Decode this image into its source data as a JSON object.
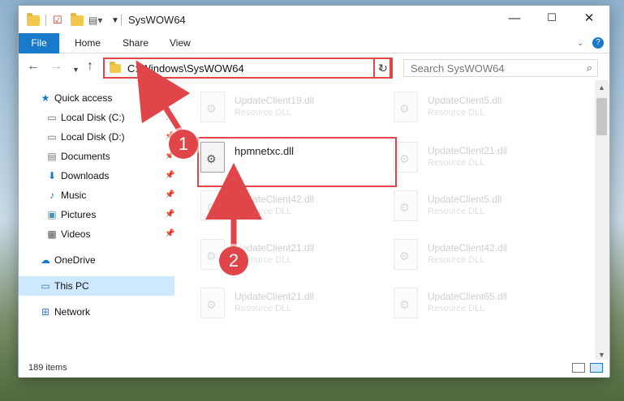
{
  "window": {
    "title": "SysWOW64",
    "controls": {
      "minimize": "—",
      "maximize": "☐",
      "close": "✕"
    }
  },
  "ribbon": {
    "tabs": [
      "File",
      "Home",
      "Share",
      "View"
    ]
  },
  "nav": {
    "address": "C:\\Windows\\SysWOW64",
    "search_placeholder": "Search SysWOW64"
  },
  "sidebar": {
    "items": [
      {
        "label": "Quick access",
        "icon": "star-icon"
      },
      {
        "label": "Local Disk (C:)",
        "icon": "drive-icon"
      },
      {
        "label": "Local Disk (D:)",
        "icon": "drive-icon"
      },
      {
        "label": "Documents",
        "icon": "documents-icon"
      },
      {
        "label": "Downloads",
        "icon": "download-icon"
      },
      {
        "label": "Music",
        "icon": "music-icon"
      },
      {
        "label": "Pictures",
        "icon": "pictures-icon"
      },
      {
        "label": "Videos",
        "icon": "videos-icon"
      },
      {
        "label": "OneDrive",
        "icon": "cloud-icon"
      },
      {
        "label": "This PC",
        "icon": "computer-icon"
      },
      {
        "label": "Network",
        "icon": "network-icon"
      }
    ]
  },
  "files": {
    "highlighted": {
      "name": "hpmnetxc.dll"
    },
    "faded": [
      {
        "name": "UpdateClient19.dll",
        "type": "Resource DLL"
      },
      {
        "name": "UpdateClient5.dll",
        "type": "Resource DLL"
      },
      {
        "name": "UpdateClient21.dll",
        "type": "Resource DLL"
      },
      {
        "name": "UpdateClient42.dll",
        "type": "Resource DLL"
      },
      {
        "name": "UpdateClient5.dll",
        "type": "Resource DLL"
      },
      {
        "name": "UpdateClient21.dll",
        "type": "Resource DLL"
      },
      {
        "name": "UpdateClient42.dll",
        "type": "Resource DLL"
      },
      {
        "name": "UpdateClient21.dll",
        "type": "Resource DLL"
      },
      {
        "name": "UpdateClient65.dll",
        "type": "Resource DLL"
      }
    ]
  },
  "status": {
    "item_count": "189 items"
  },
  "callouts": [
    "1",
    "2"
  ],
  "colors": {
    "accent": "#1979ca",
    "highlight": "#e0454a",
    "selected": "#cde8ff"
  }
}
